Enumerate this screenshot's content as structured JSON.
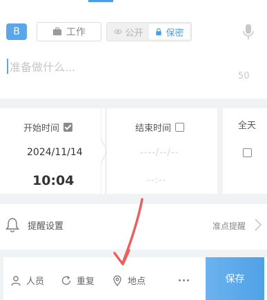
{
  "header": {
    "badge": "B",
    "category_label": "工作",
    "privacy": {
      "public_label": "公开",
      "private_label": "保密",
      "selected": "private"
    }
  },
  "input": {
    "placeholder": "准备做什么...",
    "counter": "50"
  },
  "start": {
    "label": "开始时间",
    "checked": true,
    "date": "2024/11/14",
    "time": "10:04"
  },
  "end": {
    "label": "结束时间",
    "checked": false,
    "date": "----/--/--",
    "time": "--:--"
  },
  "allday": {
    "label": "全天",
    "checked": false
  },
  "reminder": {
    "label": "提醒设置",
    "value": "准点提醒"
  },
  "bottom": {
    "people_label": "人员",
    "repeat_label": "重复",
    "location_label": "地点",
    "save_label": "保存"
  },
  "colors": {
    "accent": "#4a9de6",
    "arrow": "#e86060"
  }
}
